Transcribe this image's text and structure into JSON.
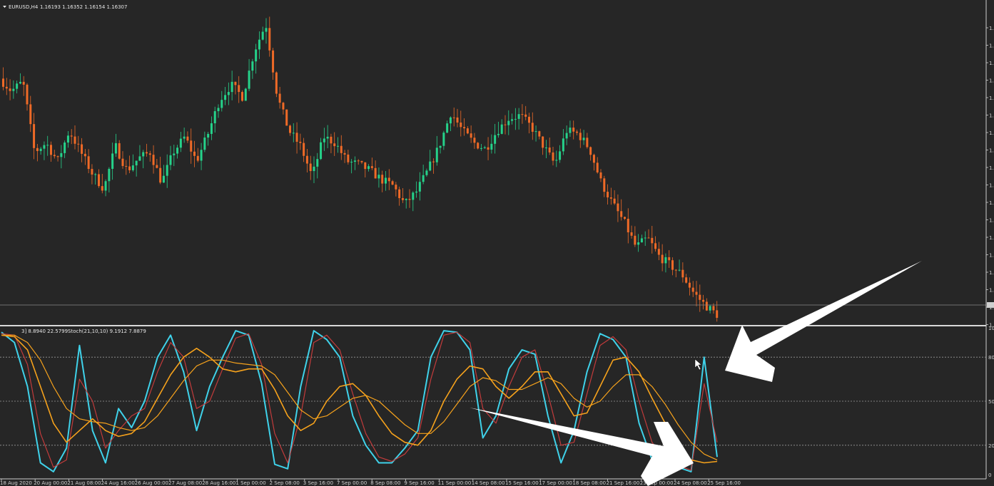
{
  "header": {
    "symbol_label": "EURUSD,H4",
    "ohlc": "1.16193 1.16352 1.16154 1.16307"
  },
  "stoch_header": {
    "text1": "3] 8.8940 22.5799",
    "text2": "Stoch(21,10,10) 9.1912 7.8879"
  },
  "colors": {
    "background": "#262626",
    "bull": "#25d28a",
    "bear": "#ef6a27",
    "stoch_fast_main": "#3fd2ea",
    "stoch_fast_signal": "#c23b3b",
    "stoch_slow_main": "#f6a21c",
    "stoch_slow_signal": "#f6a21c",
    "level_lines": "#9a9a9a",
    "arrow": "#ffffff"
  },
  "price_axis_labels": [
    "1.",
    "1.",
    "1.",
    "1.",
    "1.",
    "1.",
    "1.",
    "1.",
    "1.",
    "1.",
    "1.",
    "1.",
    "1.",
    "1.",
    "1.",
    "1.",
    "1.",
    "1."
  ],
  "stoch_axis_labels": [
    "100",
    "80",
    "50",
    "20",
    "0"
  ],
  "chart_data": {
    "type": "candlestick",
    "x_labels": [
      "18 Aug 2020",
      "20 Aug 00:00",
      "21 Aug 08:00",
      "24 Aug 16:00",
      "26 Aug 00:00",
      "27 Aug 08:00",
      "28 Aug 16:00",
      "1 Sep 00:00",
      "2 Sep 08:00",
      "3 Sep 16:00",
      "7 Sep 00:00",
      "8 Sep 08:00",
      "9 Sep 16:00",
      "11 Sep 00:00",
      "14 Sep 08:00",
      "15 Sep 16:00",
      "17 Sep 00:00",
      "18 Sep 08:00",
      "21 Sep 16:00",
      "23 Sep 00:00",
      "24 Sep 08:00",
      "25 Sep 16:00"
    ],
    "price_close_path": [
      0.79,
      0.75,
      0.78,
      0.55,
      0.58,
      0.52,
      0.62,
      0.55,
      0.48,
      0.43,
      0.57,
      0.49,
      0.53,
      0.55,
      0.45,
      0.55,
      0.6,
      0.52,
      0.61,
      0.72,
      0.77,
      0.73,
      0.88,
      0.97,
      0.73,
      0.62,
      0.57,
      0.47,
      0.6,
      0.58,
      0.52,
      0.51,
      0.49,
      0.46,
      0.44,
      0.38,
      0.42,
      0.49,
      0.57,
      0.68,
      0.62,
      0.58,
      0.56,
      0.62,
      0.66,
      0.67,
      0.63,
      0.57,
      0.51,
      0.62,
      0.61,
      0.56,
      0.45,
      0.38,
      0.32,
      0.24,
      0.27,
      0.21,
      0.18,
      0.15,
      0.09,
      0.05,
      0.02
    ],
    "stoch_panel": {
      "ylim": [
        0,
        100
      ],
      "levels": [
        80,
        50,
        20
      ],
      "series": [
        {
          "values": [
            97,
            90,
            60,
            8,
            2,
            18,
            88,
            30,
            8,
            45,
            32,
            50,
            80,
            95,
            70,
            30,
            60,
            80,
            98,
            95,
            62,
            7,
            4,
            60,
            98,
            92,
            80,
            40,
            20,
            8,
            8,
            18,
            30,
            80,
            98,
            97,
            85,
            25,
            40,
            72,
            85,
            82,
            40,
            8,
            30,
            70,
            96,
            92,
            80,
            35,
            10,
            8,
            5,
            2,
            80,
            12
          ]
        },
        {
          "values": [
            96,
            95,
            75,
            28,
            5,
            10,
            65,
            50,
            18,
            30,
            40,
            45,
            70,
            90,
            80,
            45,
            50,
            72,
            93,
            96,
            75,
            28,
            8,
            40,
            90,
            95,
            85,
            55,
            28,
            12,
            9,
            14,
            25,
            65,
            95,
            97,
            90,
            45,
            35,
            60,
            80,
            85,
            55,
            20,
            22,
            55,
            88,
            94,
            85,
            50,
            22,
            10,
            6,
            3,
            62,
            22
          ]
        },
        {
          "values": [
            95,
            94,
            85,
            60,
            35,
            22,
            30,
            38,
            30,
            26,
            28,
            36,
            52,
            68,
            80,
            86,
            80,
            72,
            70,
            72,
            72,
            58,
            40,
            30,
            35,
            50,
            60,
            62,
            54,
            40,
            28,
            22,
            20,
            30,
            50,
            65,
            74,
            72,
            60,
            52,
            60,
            70,
            70,
            55,
            40,
            42,
            60,
            78,
            80,
            70,
            52,
            35,
            20,
            10,
            8,
            9
          ]
        },
        {
          "values": [
            95,
            95,
            90,
            78,
            60,
            45,
            38,
            36,
            35,
            32,
            30,
            32,
            40,
            52,
            64,
            74,
            78,
            78,
            76,
            75,
            74,
            68,
            56,
            44,
            38,
            40,
            46,
            52,
            54,
            50,
            42,
            34,
            28,
            28,
            36,
            48,
            60,
            66,
            64,
            58,
            58,
            62,
            66,
            62,
            52,
            46,
            50,
            60,
            68,
            68,
            60,
            48,
            34,
            22,
            14,
            10
          ]
        }
      ]
    }
  }
}
